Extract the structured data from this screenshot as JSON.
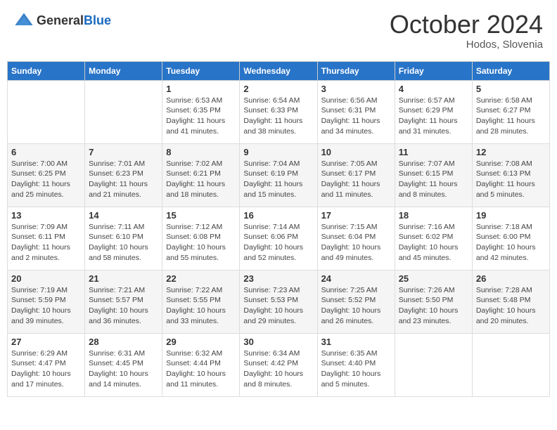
{
  "header": {
    "logo_general": "General",
    "logo_blue": "Blue",
    "month_title": "October 2024",
    "subtitle": "Hodos, Slovenia"
  },
  "weekdays": [
    "Sunday",
    "Monday",
    "Tuesday",
    "Wednesday",
    "Thursday",
    "Friday",
    "Saturday"
  ],
  "weeks": [
    [
      {
        "day": "",
        "info": ""
      },
      {
        "day": "",
        "info": ""
      },
      {
        "day": "1",
        "info": "Sunrise: 6:53 AM\nSunset: 6:35 PM\nDaylight: 11 hours and 41 minutes."
      },
      {
        "day": "2",
        "info": "Sunrise: 6:54 AM\nSunset: 6:33 PM\nDaylight: 11 hours and 38 minutes."
      },
      {
        "day": "3",
        "info": "Sunrise: 6:56 AM\nSunset: 6:31 PM\nDaylight: 11 hours and 34 minutes."
      },
      {
        "day": "4",
        "info": "Sunrise: 6:57 AM\nSunset: 6:29 PM\nDaylight: 11 hours and 31 minutes."
      },
      {
        "day": "5",
        "info": "Sunrise: 6:58 AM\nSunset: 6:27 PM\nDaylight: 11 hours and 28 minutes."
      }
    ],
    [
      {
        "day": "6",
        "info": "Sunrise: 7:00 AM\nSunset: 6:25 PM\nDaylight: 11 hours and 25 minutes."
      },
      {
        "day": "7",
        "info": "Sunrise: 7:01 AM\nSunset: 6:23 PM\nDaylight: 11 hours and 21 minutes."
      },
      {
        "day": "8",
        "info": "Sunrise: 7:02 AM\nSunset: 6:21 PM\nDaylight: 11 hours and 18 minutes."
      },
      {
        "day": "9",
        "info": "Sunrise: 7:04 AM\nSunset: 6:19 PM\nDaylight: 11 hours and 15 minutes."
      },
      {
        "day": "10",
        "info": "Sunrise: 7:05 AM\nSunset: 6:17 PM\nDaylight: 11 hours and 11 minutes."
      },
      {
        "day": "11",
        "info": "Sunrise: 7:07 AM\nSunset: 6:15 PM\nDaylight: 11 hours and 8 minutes."
      },
      {
        "day": "12",
        "info": "Sunrise: 7:08 AM\nSunset: 6:13 PM\nDaylight: 11 hours and 5 minutes."
      }
    ],
    [
      {
        "day": "13",
        "info": "Sunrise: 7:09 AM\nSunset: 6:11 PM\nDaylight: 11 hours and 2 minutes."
      },
      {
        "day": "14",
        "info": "Sunrise: 7:11 AM\nSunset: 6:10 PM\nDaylight: 10 hours and 58 minutes."
      },
      {
        "day": "15",
        "info": "Sunrise: 7:12 AM\nSunset: 6:08 PM\nDaylight: 10 hours and 55 minutes."
      },
      {
        "day": "16",
        "info": "Sunrise: 7:14 AM\nSunset: 6:06 PM\nDaylight: 10 hours and 52 minutes."
      },
      {
        "day": "17",
        "info": "Sunrise: 7:15 AM\nSunset: 6:04 PM\nDaylight: 10 hours and 49 minutes."
      },
      {
        "day": "18",
        "info": "Sunrise: 7:16 AM\nSunset: 6:02 PM\nDaylight: 10 hours and 45 minutes."
      },
      {
        "day": "19",
        "info": "Sunrise: 7:18 AM\nSunset: 6:00 PM\nDaylight: 10 hours and 42 minutes."
      }
    ],
    [
      {
        "day": "20",
        "info": "Sunrise: 7:19 AM\nSunset: 5:59 PM\nDaylight: 10 hours and 39 minutes."
      },
      {
        "day": "21",
        "info": "Sunrise: 7:21 AM\nSunset: 5:57 PM\nDaylight: 10 hours and 36 minutes."
      },
      {
        "day": "22",
        "info": "Sunrise: 7:22 AM\nSunset: 5:55 PM\nDaylight: 10 hours and 33 minutes."
      },
      {
        "day": "23",
        "info": "Sunrise: 7:23 AM\nSunset: 5:53 PM\nDaylight: 10 hours and 29 minutes."
      },
      {
        "day": "24",
        "info": "Sunrise: 7:25 AM\nSunset: 5:52 PM\nDaylight: 10 hours and 26 minutes."
      },
      {
        "day": "25",
        "info": "Sunrise: 7:26 AM\nSunset: 5:50 PM\nDaylight: 10 hours and 23 minutes."
      },
      {
        "day": "26",
        "info": "Sunrise: 7:28 AM\nSunset: 5:48 PM\nDaylight: 10 hours and 20 minutes."
      }
    ],
    [
      {
        "day": "27",
        "info": "Sunrise: 6:29 AM\nSunset: 4:47 PM\nDaylight: 10 hours and 17 minutes."
      },
      {
        "day": "28",
        "info": "Sunrise: 6:31 AM\nSunset: 4:45 PM\nDaylight: 10 hours and 14 minutes."
      },
      {
        "day": "29",
        "info": "Sunrise: 6:32 AM\nSunset: 4:44 PM\nDaylight: 10 hours and 11 minutes."
      },
      {
        "day": "30",
        "info": "Sunrise: 6:34 AM\nSunset: 4:42 PM\nDaylight: 10 hours and 8 minutes."
      },
      {
        "day": "31",
        "info": "Sunrise: 6:35 AM\nSunset: 4:40 PM\nDaylight: 10 hours and 5 minutes."
      },
      {
        "day": "",
        "info": ""
      },
      {
        "day": "",
        "info": ""
      }
    ]
  ]
}
